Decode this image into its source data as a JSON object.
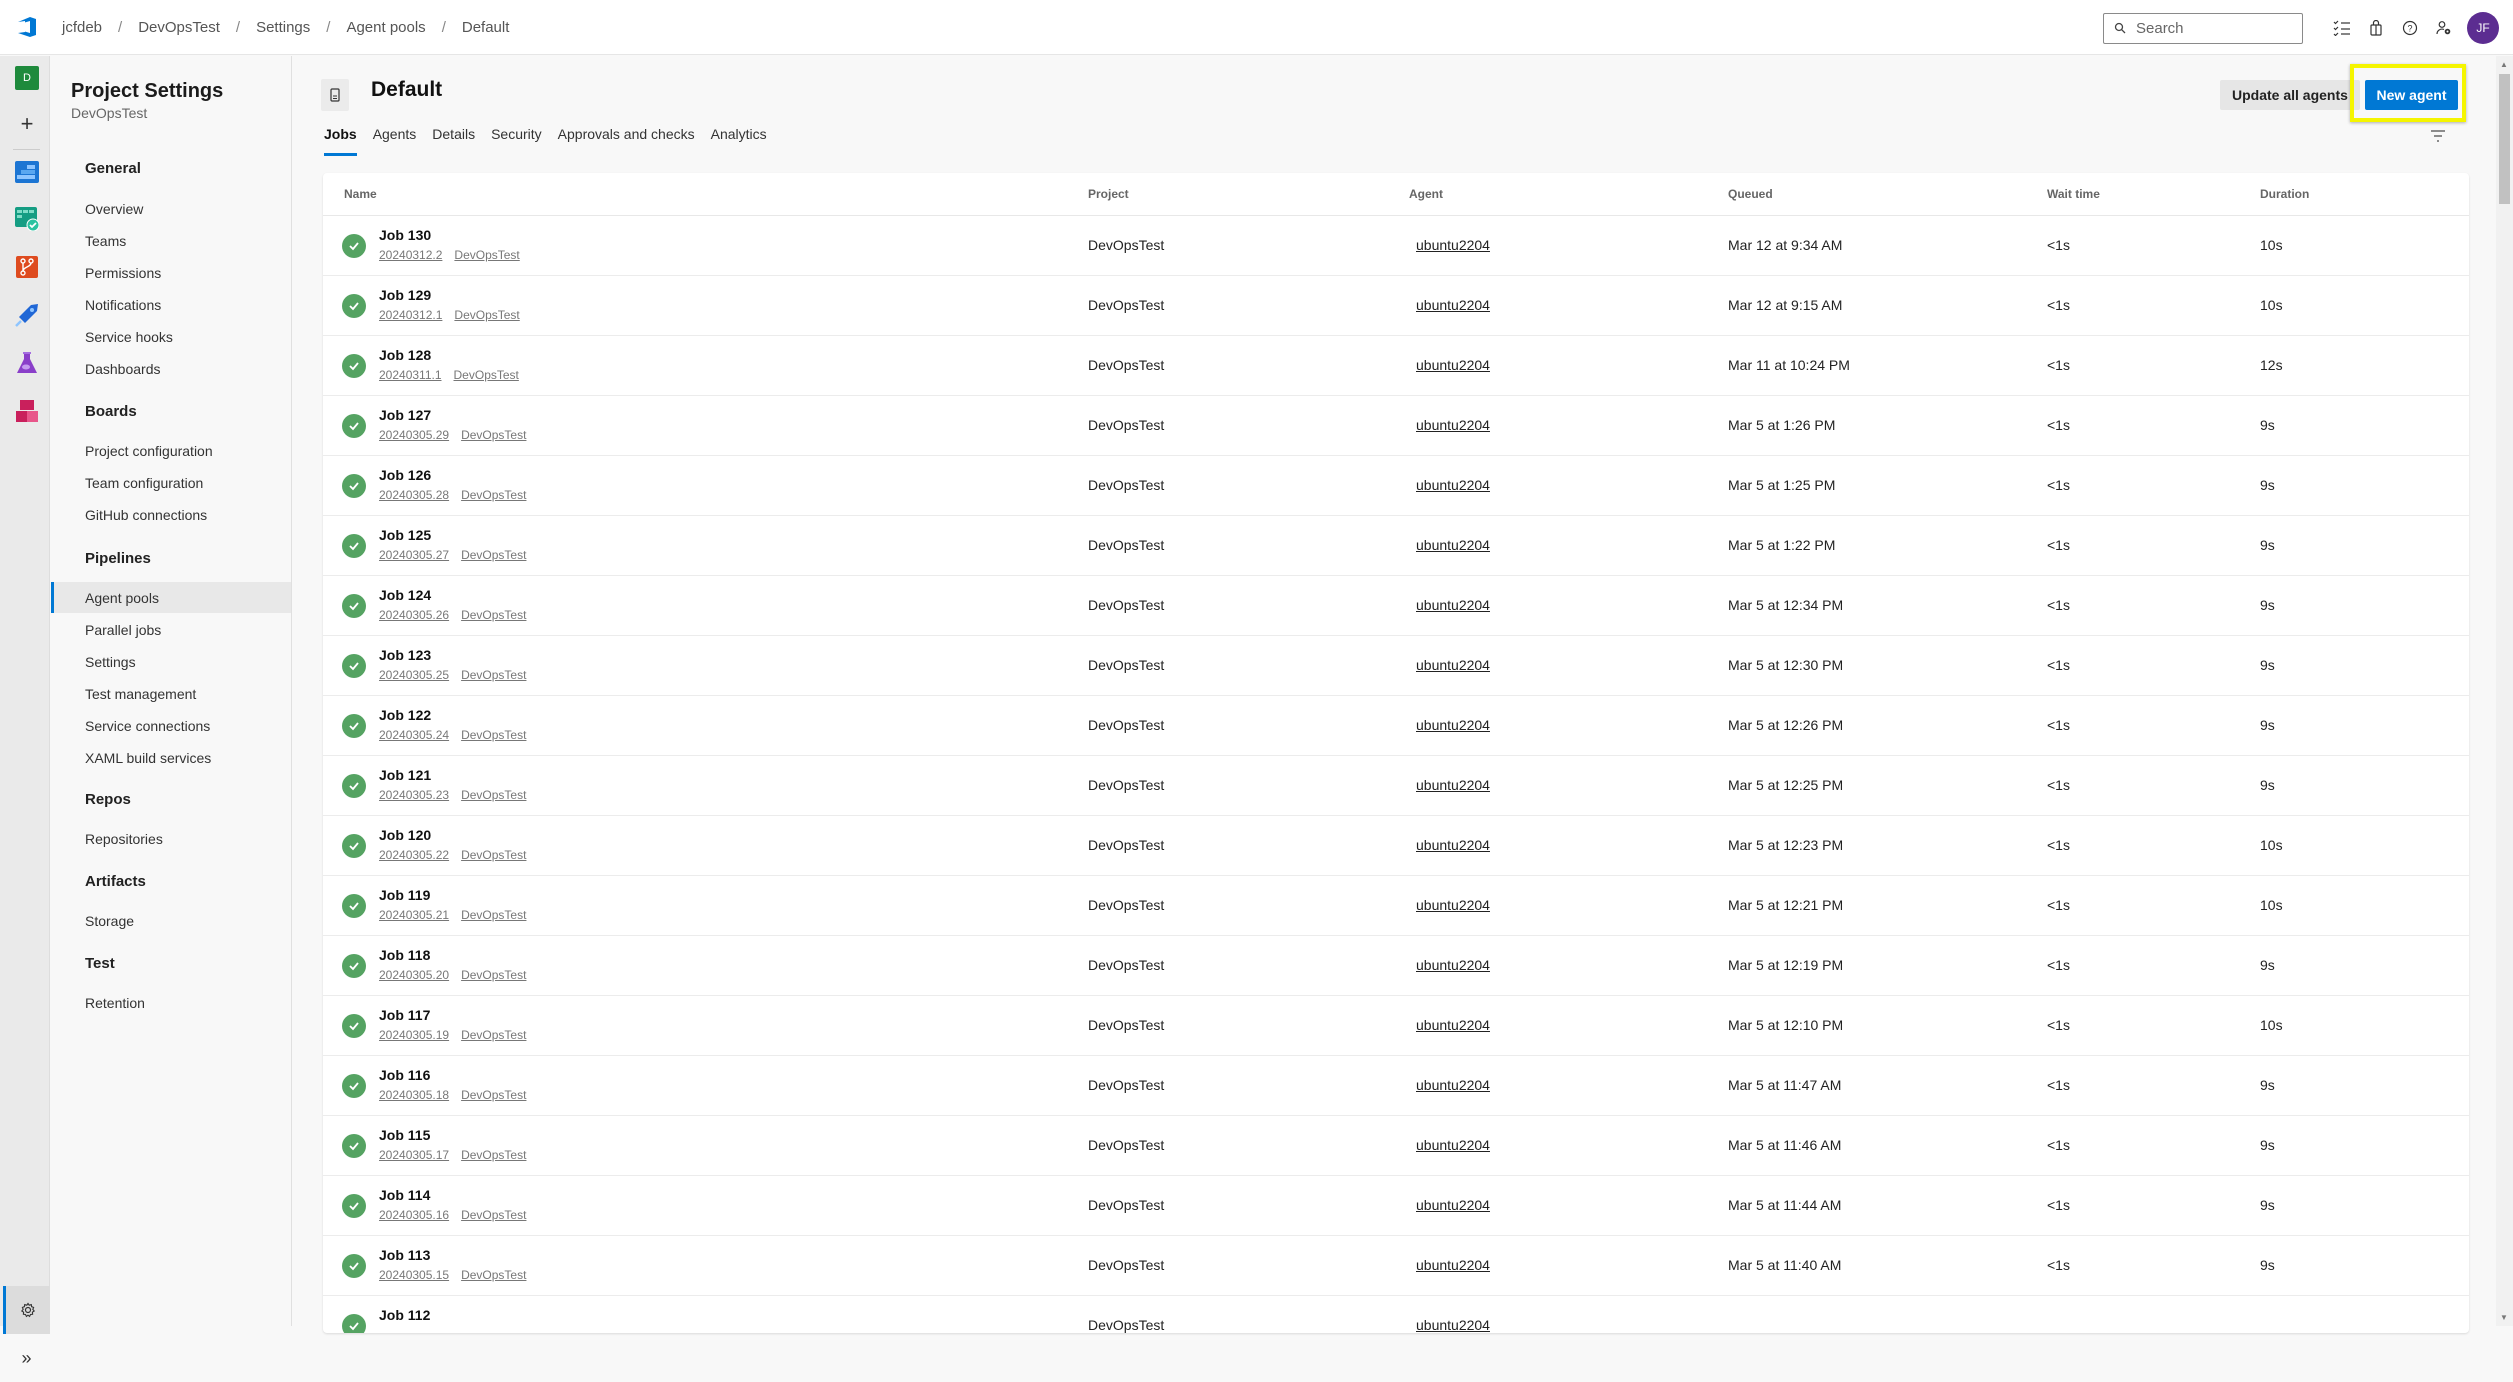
{
  "breadcrumb": [
    "jcfdeb",
    "DevOpsTest",
    "Settings",
    "Agent pools",
    "Default"
  ],
  "search": {
    "placeholder": "Search"
  },
  "user": {
    "initials": "JF",
    "avatar_color": "#5c2d91"
  },
  "rail": {
    "project_initial": "D"
  },
  "nav": {
    "title": "Project Settings",
    "subtitle": "DevOpsTest",
    "groups": [
      {
        "label": "General",
        "items": [
          "Overview",
          "Teams",
          "Permissions",
          "Notifications",
          "Service hooks",
          "Dashboards"
        ]
      },
      {
        "label": "Boards",
        "items": [
          "Project configuration",
          "Team configuration",
          "GitHub connections"
        ]
      },
      {
        "label": "Pipelines",
        "items": [
          "Agent pools",
          "Parallel jobs",
          "Settings",
          "Test management",
          "Service connections",
          "XAML build services"
        ]
      },
      {
        "label": "Repos",
        "items": [
          "Repositories"
        ]
      },
      {
        "label": "Artifacts",
        "items": [
          "Storage"
        ]
      },
      {
        "label": "Test",
        "items": [
          "Retention"
        ]
      }
    ],
    "selected": "Agent pools"
  },
  "page": {
    "title": "Default",
    "update_button": "Update all agents",
    "new_agent_button": "New agent",
    "accent_color": "#0078d4",
    "tabs": [
      "Jobs",
      "Agents",
      "Details",
      "Security",
      "Approvals and checks",
      "Analytics"
    ],
    "active_tab": "Jobs"
  },
  "table": {
    "columns": [
      "Name",
      "Project",
      "Agent",
      "Queued",
      "Wait time",
      "Duration"
    ],
    "rows": [
      {
        "name": "Job 130",
        "run": "20240312.2",
        "pipeline": "DevOpsTest",
        "project": "DevOpsTest",
        "agent": "ubuntu2204",
        "queued": "Mar 12 at 9:34 AM",
        "wait": "<1s",
        "duration": "10s"
      },
      {
        "name": "Job 129",
        "run": "20240312.1",
        "pipeline": "DevOpsTest",
        "project": "DevOpsTest",
        "agent": "ubuntu2204",
        "queued": "Mar 12 at 9:15 AM",
        "wait": "<1s",
        "duration": "10s"
      },
      {
        "name": "Job 128",
        "run": "20240311.1",
        "pipeline": "DevOpsTest",
        "project": "DevOpsTest",
        "agent": "ubuntu2204",
        "queued": "Mar 11 at 10:24 PM",
        "wait": "<1s",
        "duration": "12s"
      },
      {
        "name": "Job 127",
        "run": "20240305.29",
        "pipeline": "DevOpsTest",
        "project": "DevOpsTest",
        "agent": "ubuntu2204",
        "queued": "Mar 5 at 1:26 PM",
        "wait": "<1s",
        "duration": "9s"
      },
      {
        "name": "Job 126",
        "run": "20240305.28",
        "pipeline": "DevOpsTest",
        "project": "DevOpsTest",
        "agent": "ubuntu2204",
        "queued": "Mar 5 at 1:25 PM",
        "wait": "<1s",
        "duration": "9s"
      },
      {
        "name": "Job 125",
        "run": "20240305.27",
        "pipeline": "DevOpsTest",
        "project": "DevOpsTest",
        "agent": "ubuntu2204",
        "queued": "Mar 5 at 1:22 PM",
        "wait": "<1s",
        "duration": "9s"
      },
      {
        "name": "Job 124",
        "run": "20240305.26",
        "pipeline": "DevOpsTest",
        "project": "DevOpsTest",
        "agent": "ubuntu2204",
        "queued": "Mar 5 at 12:34 PM",
        "wait": "<1s",
        "duration": "9s"
      },
      {
        "name": "Job 123",
        "run": "20240305.25",
        "pipeline": "DevOpsTest",
        "project": "DevOpsTest",
        "agent": "ubuntu2204",
        "queued": "Mar 5 at 12:30 PM",
        "wait": "<1s",
        "duration": "9s"
      },
      {
        "name": "Job 122",
        "run": "20240305.24",
        "pipeline": "DevOpsTest",
        "project": "DevOpsTest",
        "agent": "ubuntu2204",
        "queued": "Mar 5 at 12:26 PM",
        "wait": "<1s",
        "duration": "9s"
      },
      {
        "name": "Job 121",
        "run": "20240305.23",
        "pipeline": "DevOpsTest",
        "project": "DevOpsTest",
        "agent": "ubuntu2204",
        "queued": "Mar 5 at 12:25 PM",
        "wait": "<1s",
        "duration": "9s"
      },
      {
        "name": "Job 120",
        "run": "20240305.22",
        "pipeline": "DevOpsTest",
        "project": "DevOpsTest",
        "agent": "ubuntu2204",
        "queued": "Mar 5 at 12:23 PM",
        "wait": "<1s",
        "duration": "10s"
      },
      {
        "name": "Job 119",
        "run": "20240305.21",
        "pipeline": "DevOpsTest",
        "project": "DevOpsTest",
        "agent": "ubuntu2204",
        "queued": "Mar 5 at 12:21 PM",
        "wait": "<1s",
        "duration": "10s"
      },
      {
        "name": "Job 118",
        "run": "20240305.20",
        "pipeline": "DevOpsTest",
        "project": "DevOpsTest",
        "agent": "ubuntu2204",
        "queued": "Mar 5 at 12:19 PM",
        "wait": "<1s",
        "duration": "9s"
      },
      {
        "name": "Job 117",
        "run": "20240305.19",
        "pipeline": "DevOpsTest",
        "project": "DevOpsTest",
        "agent": "ubuntu2204",
        "queued": "Mar 5 at 12:10 PM",
        "wait": "<1s",
        "duration": "10s"
      },
      {
        "name": "Job 116",
        "run": "20240305.18",
        "pipeline": "DevOpsTest",
        "project": "DevOpsTest",
        "agent": "ubuntu2204",
        "queued": "Mar 5 at 11:47 AM",
        "wait": "<1s",
        "duration": "9s"
      },
      {
        "name": "Job 115",
        "run": "20240305.17",
        "pipeline": "DevOpsTest",
        "project": "DevOpsTest",
        "agent": "ubuntu2204",
        "queued": "Mar 5 at 11:46 AM",
        "wait": "<1s",
        "duration": "9s"
      },
      {
        "name": "Job 114",
        "run": "20240305.16",
        "pipeline": "DevOpsTest",
        "project": "DevOpsTest",
        "agent": "ubuntu2204",
        "queued": "Mar 5 at 11:44 AM",
        "wait": "<1s",
        "duration": "9s"
      },
      {
        "name": "Job 113",
        "run": "20240305.15",
        "pipeline": "DevOpsTest",
        "project": "DevOpsTest",
        "agent": "ubuntu2204",
        "queued": "Mar 5 at 11:40 AM",
        "wait": "<1s",
        "duration": "9s"
      },
      {
        "name": "Job 112",
        "run": "",
        "pipeline": "",
        "project": "DevOpsTest",
        "agent": "ubuntu2204",
        "queued": "",
        "wait": "",
        "duration": ""
      }
    ]
  }
}
